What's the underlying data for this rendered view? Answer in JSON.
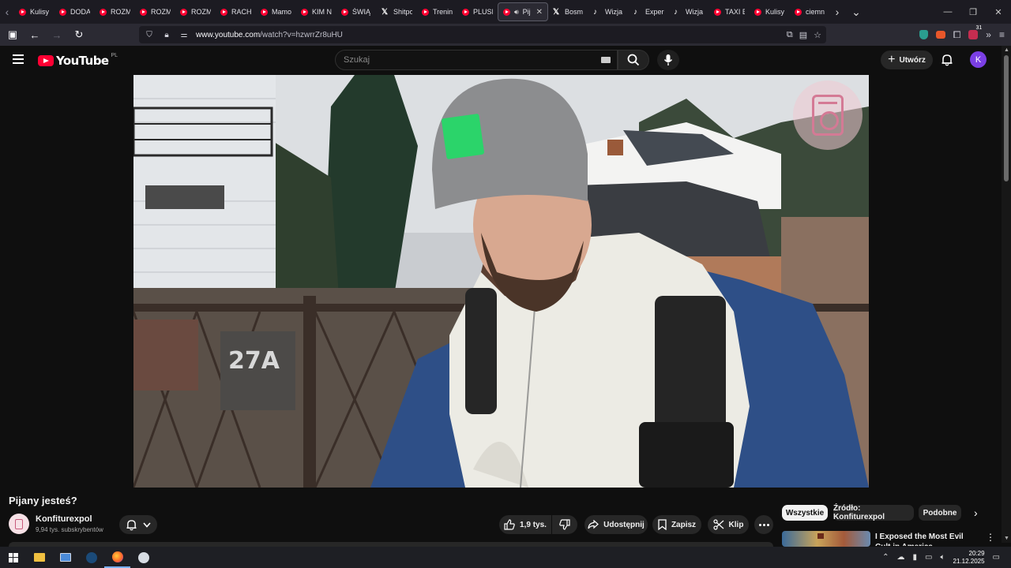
{
  "browser": {
    "tabs": [
      {
        "title": "Kulisy",
        "icon": "youtube"
      },
      {
        "title": "DODA",
        "icon": "youtube"
      },
      {
        "title": "ROZM",
        "icon": "youtube"
      },
      {
        "title": "ROZM",
        "icon": "youtube"
      },
      {
        "title": "ROZM",
        "icon": "youtube"
      },
      {
        "title": "RACH",
        "icon": "youtube"
      },
      {
        "title": "Mamo",
        "icon": "youtube"
      },
      {
        "title": "KIM N",
        "icon": "youtube"
      },
      {
        "title": "ŚWIĄ",
        "icon": "youtube"
      },
      {
        "title": "Shitpo",
        "icon": "x"
      },
      {
        "title": "Trenin",
        "icon": "youtube"
      },
      {
        "title": "PLUSI",
        "icon": "youtube"
      },
      {
        "title": "Pija",
        "icon": "youtube",
        "active": true
      },
      {
        "title": "Bosm",
        "icon": "x"
      },
      {
        "title": "Wizja",
        "icon": "tiktok"
      },
      {
        "title": "Experi",
        "icon": "tiktok"
      },
      {
        "title": "Wizja",
        "icon": "tiktok"
      },
      {
        "title": "TAXI E",
        "icon": "youtube"
      },
      {
        "title": "Kulisy",
        "icon": "youtube"
      },
      {
        "title": "ciemn",
        "icon": "youtube"
      }
    ],
    "url_host": "www.youtube.com",
    "url_path": "/watch?v=hzwrrZr8uHU",
    "ext_badge": "31"
  },
  "youtube": {
    "logo_text": "YouTube",
    "country_code": "PL",
    "search_placeholder": "Szukaj",
    "create_label": "Utwórz",
    "avatar_letter": "K"
  },
  "player": {
    "house_number": "27A"
  },
  "video": {
    "title": "Pijany jesteś?",
    "channel": "Konfiturexpol",
    "subscribers": "9,94 tys. subskrybentów",
    "likes": "1,9 tys.",
    "share_label": "Udostępnij",
    "save_label": "Zapisz",
    "clip_label": "Klip"
  },
  "recommendations": {
    "chips": [
      "Wszystkie",
      "Źródło: Konfiturexpol",
      "Podobne"
    ],
    "first_title": "I Exposed the Most Evil Cult in America"
  },
  "taskbar": {
    "time": "20:29",
    "date": "21.12.2025"
  },
  "colors": {
    "brand_red": "#ff0033",
    "background": "#0f0f0f",
    "avatar": "#7b3fe4"
  }
}
